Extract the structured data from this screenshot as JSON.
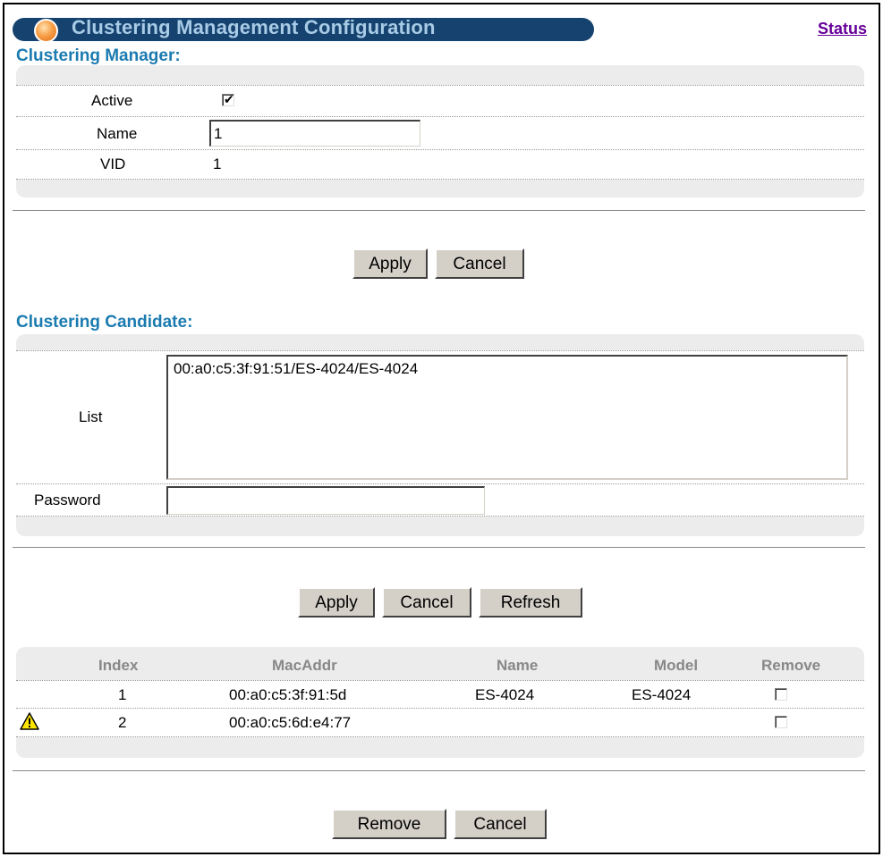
{
  "header": {
    "title": "Clustering Management Configuration",
    "status_link": "Status"
  },
  "manager": {
    "section_title": "Clustering Manager:",
    "active_label": "Active",
    "active_checked": true,
    "name_label": "Name",
    "name_value": "1",
    "vid_label": "VID",
    "vid_value": "1",
    "apply_label": "Apply",
    "cancel_label": "Cancel"
  },
  "candidate": {
    "section_title": "Clustering Candidate:",
    "list_label": "List",
    "list_items": [
      "00:a0:c5:3f:91:51/ES-4024/ES-4024"
    ],
    "password_label": "Password",
    "password_value": "",
    "apply_label": "Apply",
    "cancel_label": "Cancel",
    "refresh_label": "Refresh"
  },
  "members": {
    "columns": [
      "Index",
      "MacAddr",
      "Name",
      "Model",
      "Remove"
    ],
    "rows": [
      {
        "warning": false,
        "index": "1",
        "mac": "00:a0:c5:3f:91:5d",
        "name": "ES-4024",
        "model": "ES-4024",
        "remove": false
      },
      {
        "warning": true,
        "index": "2",
        "mac": "00:a0:c5:6d:e4:77",
        "name": "",
        "model": "",
        "remove": false
      }
    ],
    "remove_label": "Remove",
    "cancel_label": "Cancel"
  },
  "icons": {
    "warning": "warning-triangle-icon",
    "orb": "orange-orb-icon"
  },
  "colors": {
    "title_bar": "#16426f",
    "title_text": "#a8cbe6",
    "section_title": "#1b7bb0",
    "status_link": "#660099",
    "panel_bg": "#ececec"
  }
}
